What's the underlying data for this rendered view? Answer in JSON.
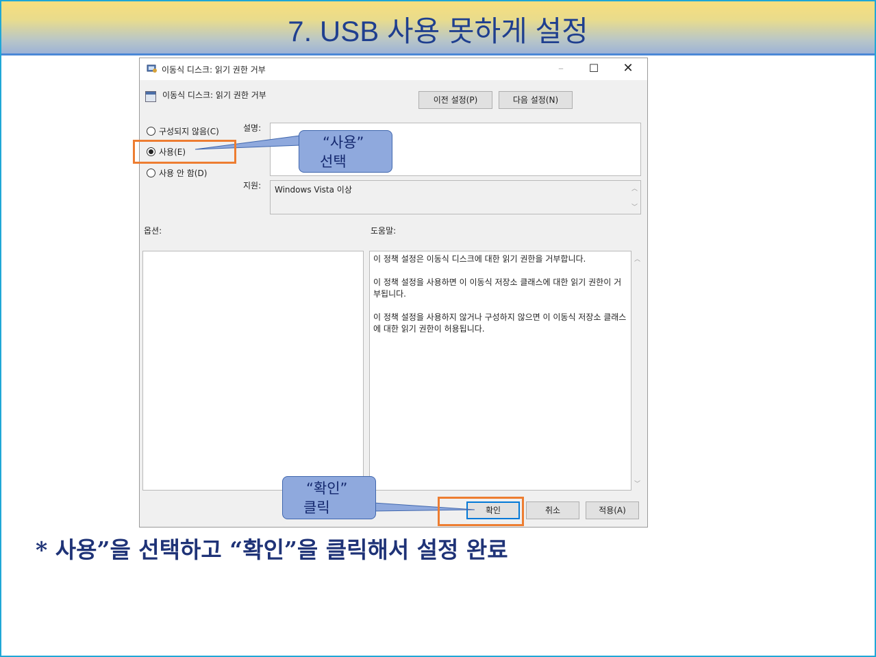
{
  "slide": {
    "title": "7. USB 사용 못하게 설정",
    "note": "* 사용”을 선택하고 “확인”을 클릭해서 설정 완료"
  },
  "dialog": {
    "window_title": "이동식 디스크: 읽기 권한 거부",
    "header_title": "이동식 디스크: 읽기 권한 거부",
    "prev_button": "이전 설정(P)",
    "next_button": "다음 설정(N)",
    "radios": {
      "not_configured": "구성되지 않음(C)",
      "enabled": "사용(E)",
      "disabled": "사용 안 함(D)",
      "selected": "enabled"
    },
    "comment_label": "설명:",
    "comment_value": "",
    "supported_label": "지원:",
    "supported_value": "Windows Vista 이상",
    "options_label": "옵션:",
    "help_label": "도움말:",
    "help_paragraphs": [
      "이 정책 설정은 이동식 디스크에 대한 읽기 권한을 거부합니다.",
      "이 정책 설정을 사용하면 이 이동식 저장소 클래스에 대한 읽기 권한이 거부됩니다.",
      "이 정책 설정을 사용하지 않거나 구성하지 않으면 이 이동식 저장소 클래스에 대한 읽기 권한이 허용됩니다."
    ],
    "ok_button": "확인",
    "cancel_button": "취소",
    "apply_button": "적용(A)"
  },
  "callouts": {
    "select_line1": "“사용”",
    "select_line2": "선택",
    "click_line1": "“확인”",
    "click_line2": "클릭"
  },
  "colors": {
    "title_text": "#1f3f8f",
    "callout_fill": "#8fa9dd",
    "highlight_border": "#ed7d31",
    "default_button_border": "#0078d7"
  },
  "icons": [
    "policy-app-icon",
    "policy-setting-icon",
    "minimize-icon",
    "maximize-icon",
    "close-icon"
  ]
}
